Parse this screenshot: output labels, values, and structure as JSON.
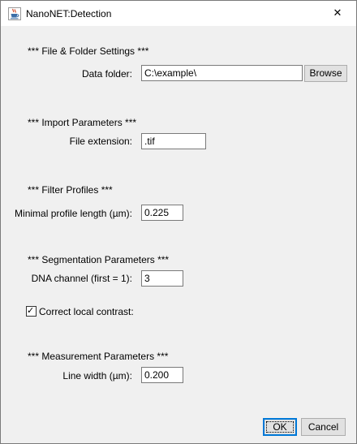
{
  "window": {
    "title": "NanoNET:Detection",
    "close_glyph": "✕"
  },
  "sections": {
    "file_folder": "***  File & Folder Settings  ***",
    "import": "***  Import Parameters  ***",
    "filter": "***  Filter Profiles  ***",
    "segmentation": "***  Segmentation Parameters  ***",
    "measurement": "***  Measurement Parameters  ***"
  },
  "fields": {
    "data_folder": {
      "label": "Data folder:",
      "value": "C:\\example\\"
    },
    "file_extension": {
      "label": "File extension:",
      "value": ".tif"
    },
    "min_profile_length": {
      "label": "Minimal profile length (µm):",
      "value": "0.225"
    },
    "dna_channel": {
      "label": "DNA channel (first = 1):",
      "value": "3"
    },
    "line_width": {
      "label": "Line width (µm):",
      "value": "0.200"
    }
  },
  "checkbox": {
    "label": "Correct local contrast:",
    "checked": true,
    "check_glyph": "✓"
  },
  "buttons": {
    "browse": "Browse",
    "ok": "OK",
    "cancel": "Cancel"
  }
}
